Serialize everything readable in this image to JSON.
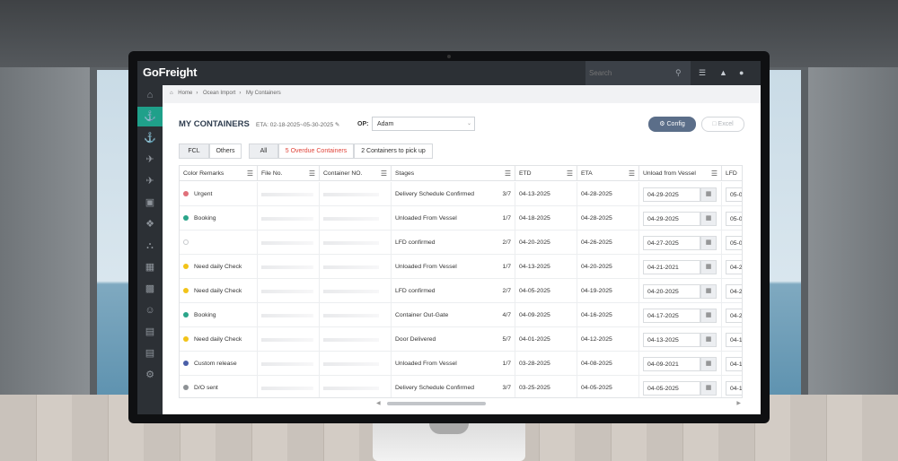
{
  "app": {
    "logo": "GoFreight"
  },
  "topbar": {
    "search_placeholder": "Search"
  },
  "breadcrumb": [
    "Home",
    "Ocean Import",
    "My Containers"
  ],
  "page": {
    "title": "MY CONTAINERS",
    "eta_range": "ETA: 02-18-2025~05-30-2025",
    "op_label": "OP:",
    "op_value": "Adam",
    "config_label": "Config",
    "excel_label": "Excel"
  },
  "filters": {
    "fcl": "FCL",
    "others": "Others",
    "all": "All",
    "overdue": "5 Overdue Containers",
    "pickup": "2 Containers to pick up"
  },
  "columns": [
    "Color Remarks",
    "File No.",
    "Container NO.",
    "Stages",
    "ETD",
    "ETA",
    "Unload from Vessel",
    "LFD"
  ],
  "rows": [
    {
      "remark": "Urgent",
      "color": "#e0707a",
      "stage": "Delivery Schedule Confirmed",
      "step": "3/7",
      "etd": "04-13-2025",
      "eta": "04-28-2025",
      "unload": "04-29-2025",
      "lfd": "05-0"
    },
    {
      "remark": "Booking",
      "color": "#2aa58a",
      "stage": "Unloaded From Vessel",
      "step": "1/7",
      "etd": "04-18-2025",
      "eta": "04-28-2025",
      "unload": "04-29-2025",
      "lfd": "05-0"
    },
    {
      "remark": "",
      "color": "#ffffff",
      "stage": "LFD confirmed",
      "step": "2/7",
      "etd": "04-20-2025",
      "eta": "04-26-2025",
      "unload": "04-27-2025",
      "lfd": "05-0"
    },
    {
      "remark": "Need daily Check",
      "color": "#f2c318",
      "stage": "Unloaded From Vessel",
      "step": "1/7",
      "etd": "04-13-2025",
      "eta": "04-20-2025",
      "unload": "04-21-2021",
      "lfd": "04-2"
    },
    {
      "remark": "Need daily Check",
      "color": "#f2c318",
      "stage": "LFD confirmed",
      "step": "2/7",
      "etd": "04-05-2025",
      "eta": "04-19-2025",
      "unload": "04-20-2025",
      "lfd": "04-2"
    },
    {
      "remark": "Booking",
      "color": "#2aa58a",
      "stage": "Container Out-Gate",
      "step": "4/7",
      "etd": "04-09-2025",
      "eta": "04-16-2025",
      "unload": "04-17-2025",
      "lfd": "04-2"
    },
    {
      "remark": "Need daily Check",
      "color": "#f2c318",
      "stage": "Door Delivered",
      "step": "5/7",
      "etd": "04-01-2025",
      "eta": "04-12-2025",
      "unload": "04-13-2025",
      "lfd": "04-1"
    },
    {
      "remark": "Custom release",
      "color": "#4a5fa8",
      "stage": "Unloaded From Vessel",
      "step": "1/7",
      "etd": "03-28-2025",
      "eta": "04-08-2025",
      "unload": "04-09-2021",
      "lfd": "04-1"
    },
    {
      "remark": "D/O sent",
      "color": "#8e9296",
      "stage": "Delivery Schedule Confirmed",
      "step": "3/7",
      "etd": "03-25-2025",
      "eta": "04-05-2025",
      "unload": "04-05-2025",
      "lfd": "04-1"
    }
  ]
}
